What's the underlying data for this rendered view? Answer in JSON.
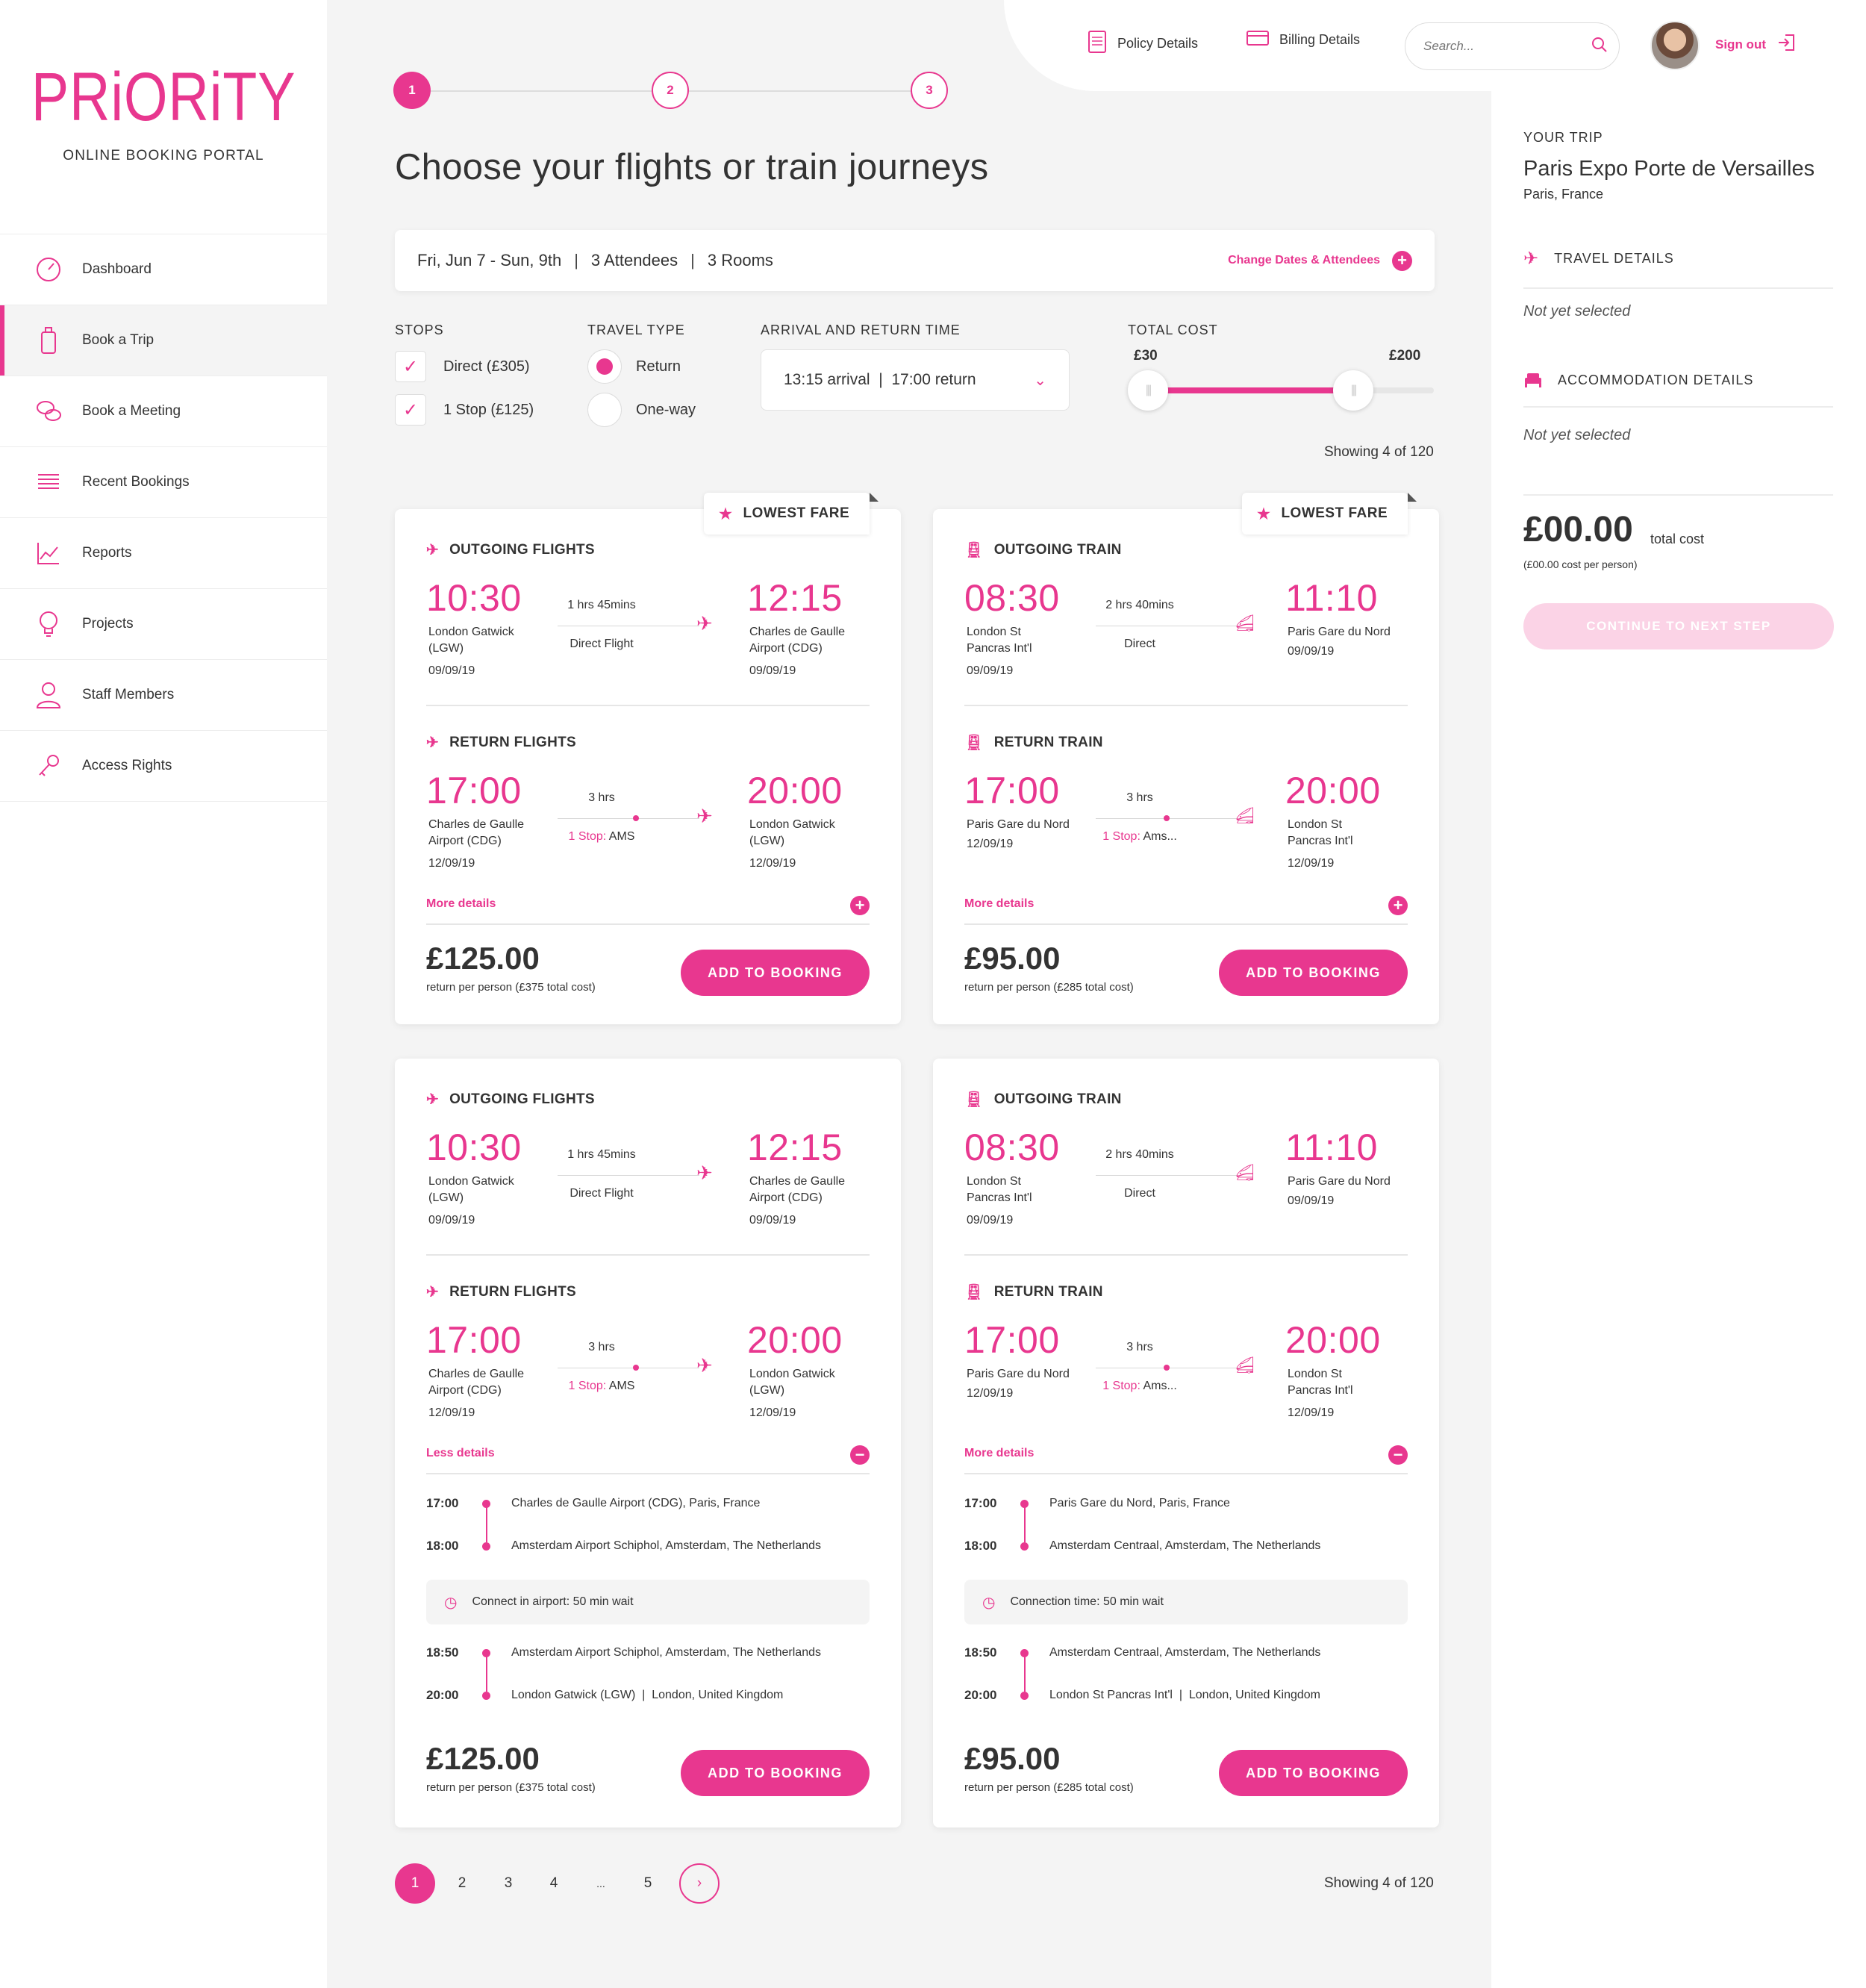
{
  "brand": {
    "logo": "PRiORiTY",
    "subtitle": "ONLINE BOOKING PORTAL",
    "accent": "#e8378f"
  },
  "sidebar": {
    "items": [
      {
        "label": "Dashboard",
        "icon": "speedometer-icon"
      },
      {
        "label": "Book a Trip",
        "icon": "luggage-icon",
        "active": true
      },
      {
        "label": "Book a Meeting",
        "icon": "chat-bubbles-icon"
      },
      {
        "label": "Recent Bookings",
        "icon": "list-icon"
      },
      {
        "label": "Reports",
        "icon": "line-chart-icon"
      },
      {
        "label": "Projects",
        "icon": "lightbulb-icon"
      },
      {
        "label": "Staff Members",
        "icon": "user-icon"
      },
      {
        "label": "Access Rights",
        "icon": "key-icon"
      }
    ]
  },
  "header": {
    "policy": "Policy Details",
    "billing": "Billing Details",
    "search_placeholder": "Search...",
    "signout": "Sign out"
  },
  "steps": [
    "1",
    "2",
    "3"
  ],
  "page_title": "Choose your flights or train journeys",
  "summary": {
    "dates": "Fri, Jun 7 - Sun, 9th",
    "attendees": "3 Attendees",
    "rooms": "3 Rooms",
    "change": "Change Dates & Attendees"
  },
  "filters": {
    "stops_label": "STOPS",
    "stops": [
      "Direct (£305)",
      "1 Stop (£125)"
    ],
    "travel_label": "TRAVEL TYPE",
    "travel": [
      "Return",
      "One-way"
    ],
    "travel_selected": "Return",
    "time_label": "ARRIVAL AND RETURN TIME",
    "time_value": "13:15 arrival  |  17:00 return",
    "cost_label": "TOTAL COST",
    "cost_min": "£30",
    "cost_max": "£200"
  },
  "showing": "Showing 4 of 120",
  "cards": [
    {
      "badge": "LOWEST FARE",
      "out_head": "OUTGOING FLIGHTS",
      "out": {
        "dep": "10:30",
        "dep_place": "London Gatwick (LGW)",
        "dep_date": "09/09/19",
        "dur": "1 hrs 45mins",
        "kind": "Direct Flight",
        "arr": "12:15",
        "arr_place": "Charles de Gaulle Airport (CDG)",
        "arr_date": "09/09/19"
      },
      "ret_head": "RETURN FLIGHTS",
      "ret": {
        "dep": "17:00",
        "dep_place": "Charles de Gaulle Airport (CDG)",
        "dep_date": "12/09/19",
        "dur": "3 hrs",
        "stop_label": "1 Stop:",
        "stop_val": "AMS",
        "arr": "20:00",
        "arr_place": "London Gatwick (LGW)",
        "arr_date": "12/09/19"
      },
      "more": "More details",
      "price": "£125.00",
      "price_note": "return per person  (£375 total cost)",
      "add": "ADD TO BOOKING"
    },
    {
      "badge": "LOWEST FARE",
      "out_head": "OUTGOING TRAIN",
      "out": {
        "dep": "08:30",
        "dep_place": "London St Pancras Int'l",
        "dep_date": "09/09/19",
        "dur": "2 hrs 40mins",
        "kind": "Direct",
        "arr": "11:10",
        "arr_place": "Paris Gare du Nord",
        "arr_date": "09/09/19"
      },
      "ret_head": "RETURN TRAIN",
      "ret": {
        "dep": "17:00",
        "dep_place": "Paris Gare du Nord",
        "dep_date": "12/09/19",
        "dur": "3 hrs",
        "stop_label": "1 Stop:",
        "stop_val": "Ams...",
        "arr": "20:00",
        "arr_place": "London St Pancras Int'l",
        "arr_date": "12/09/19"
      },
      "more": "More details",
      "price": "£95.00",
      "price_note": "return per person  (£285 total cost)",
      "add": "ADD TO BOOKING"
    },
    {
      "out_head": "OUTGOING FLIGHTS",
      "out": {
        "dep": "10:30",
        "dep_place": "London Gatwick (LGW)",
        "dep_date": "09/09/19",
        "dur": "1 hrs 45mins",
        "kind": "Direct Flight",
        "arr": "12:15",
        "arr_place": "Charles de Gaulle Airport (CDG)",
        "arr_date": "09/09/19"
      },
      "ret_head": "RETURN FLIGHTS",
      "ret": {
        "dep": "17:00",
        "dep_place": "Charles de Gaulle Airport (CDG)",
        "dep_date": "12/09/19",
        "dur": "3 hrs",
        "stop_label": "1 Stop:",
        "stop_val": "AMS",
        "arr": "20:00",
        "arr_place": "London Gatwick (LGW)",
        "arr_date": "12/09/19"
      },
      "more": "Less details",
      "details": [
        {
          "time": "17:00",
          "place": "Charles de Gaulle Airport (CDG), Paris, France"
        },
        {
          "time": "18:00",
          "place": "Amsterdam Airport Schiphol, Amsterdam, The Netherlands"
        },
        {
          "time": "18:50",
          "place": "Amsterdam Airport Schiphol, Amsterdam, The Netherlands"
        },
        {
          "time": "20:00",
          "place": "London Gatwick (LGW)  |  London, United Kingdom"
        }
      ],
      "connect": "Connect in airport: 50 min wait",
      "price": "£125.00",
      "price_note": "return per person  (£375 total cost)",
      "add": "ADD TO BOOKING"
    },
    {
      "out_head": "OUTGOING TRAIN",
      "out": {
        "dep": "08:30",
        "dep_place": "London St Pancras Int'l",
        "dep_date": "09/09/19",
        "dur": "2 hrs 40mins",
        "kind": "Direct",
        "arr": "11:10",
        "arr_place": "Paris Gare du Nord",
        "arr_date": "09/09/19"
      },
      "ret_head": "RETURN TRAIN",
      "ret": {
        "dep": "17:00",
        "dep_place": "Paris Gare du Nord",
        "dep_date": "12/09/19",
        "dur": "3 hrs",
        "stop_label": "1 Stop:",
        "stop_val": "Ams...",
        "arr": "20:00",
        "arr_place": "London St Pancras Int'l",
        "arr_date": "12/09/19"
      },
      "more": "More details",
      "details": [
        {
          "time": "17:00",
          "place": "Paris Gare du Nord, Paris, France"
        },
        {
          "time": "18:00",
          "place": "Amsterdam Centraal, Amsterdam, The Netherlands"
        },
        {
          "time": "18:50",
          "place": "Amsterdam Centraal, Amsterdam, The Netherlands"
        },
        {
          "time": "20:00",
          "place": "London St Pancras Int'l  |  London, United Kingdom"
        }
      ],
      "connect": "Connection time: 50 min wait",
      "price": "£95.00",
      "price_note": "return per person  (£285 total cost)",
      "add": "ADD TO BOOKING"
    }
  ],
  "pagination": [
    "1",
    "2",
    "3",
    "4",
    "...",
    "5"
  ],
  "panel": {
    "your_trip": "YOUR TRIP",
    "trip_name": "Paris Expo Porte de Versailles",
    "trip_loc": "Paris, France",
    "travel": "TRAVEL DETAILS",
    "accom": "ACCOMMODATION DETAILS",
    "not_selected": "Not yet selected",
    "total": "£00.00",
    "total_label": "total cost",
    "per_person": "(£00.00 cost per person)",
    "continue": "CONTINUE TO NEXT STEP"
  }
}
